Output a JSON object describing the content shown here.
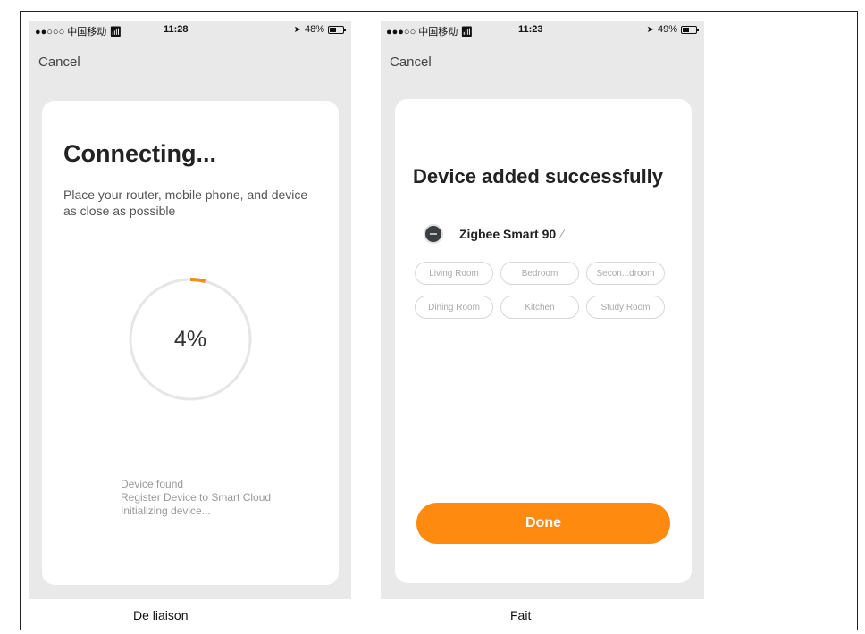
{
  "left_screen": {
    "status": {
      "carrier": "●●○○○ 中国移动",
      "time": "11:28",
      "battery": "48%",
      "battery_level": 0.48
    },
    "cancel_label": "Cancel",
    "title": "Connecting...",
    "hint": "Place your router, mobile phone, and device as close as possible",
    "progress_percent": 4,
    "progress_label": "4%",
    "steps": [
      "Device found",
      "Register Device to Smart Cloud",
      "Initializing device..."
    ]
  },
  "right_screen": {
    "status": {
      "carrier": "●●●○○ 中国移动",
      "time": "11:23",
      "battery": "49%",
      "battery_level": 0.49
    },
    "cancel_label": "Cancel",
    "title": "Device added successfully",
    "device_name": "Zigbee Smart 90",
    "rooms": [
      "Living Room",
      "Bedroom",
      "Secon...droom",
      "Dining Room",
      "Kitchen",
      "Study Room"
    ],
    "done_label": "Done"
  },
  "captions": {
    "left": "De liaison",
    "right": "Fait"
  },
  "colors": {
    "accent": "#ff8a10",
    "progress_track": "#e6e6e6",
    "phone_bg": "#e9e9e9"
  },
  "icons": {
    "wifi": "wifi-icon",
    "location": "location-arrow-icon",
    "battery": "battery-icon",
    "edit": "pencil-icon"
  }
}
